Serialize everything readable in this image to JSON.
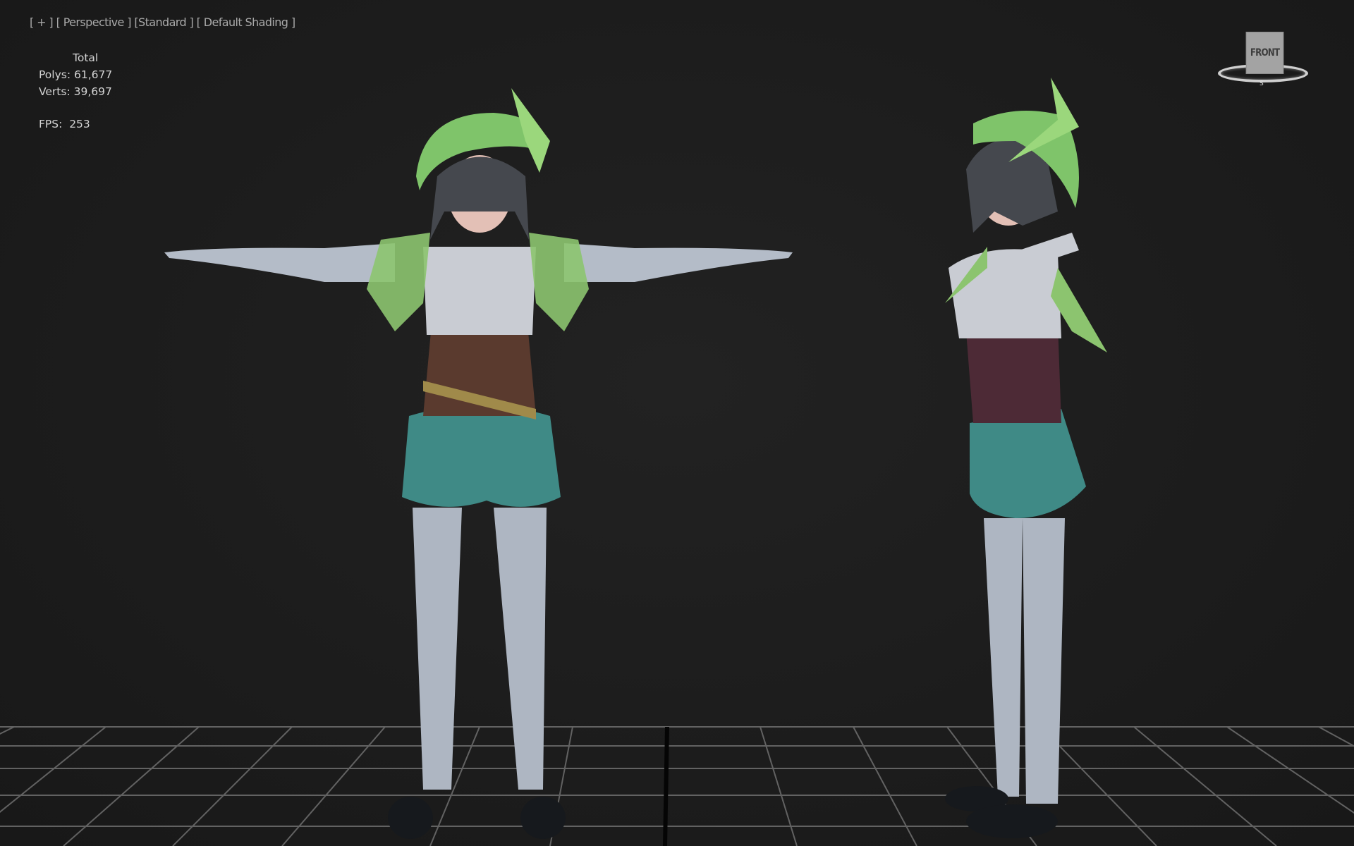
{
  "viewport": {
    "label_items": [
      "[ + ]",
      "[ Perspective ]",
      "[Standard ]",
      "[ Default Shading ]"
    ],
    "stats": {
      "heading": "Total",
      "polys_label": "Polys:",
      "polys_value": "61,677",
      "verts_label": "Verts:",
      "verts_value": "39,697",
      "fps_label": "FPS:",
      "fps_value": "253"
    },
    "viewcube": {
      "face_label": "FRONT",
      "compass_label": "S"
    }
  },
  "colors": {
    "background": "#1c1c1c",
    "grid": "#8a8a8a",
    "hat": "#7fc46a",
    "shorts": "#3f8a86"
  }
}
